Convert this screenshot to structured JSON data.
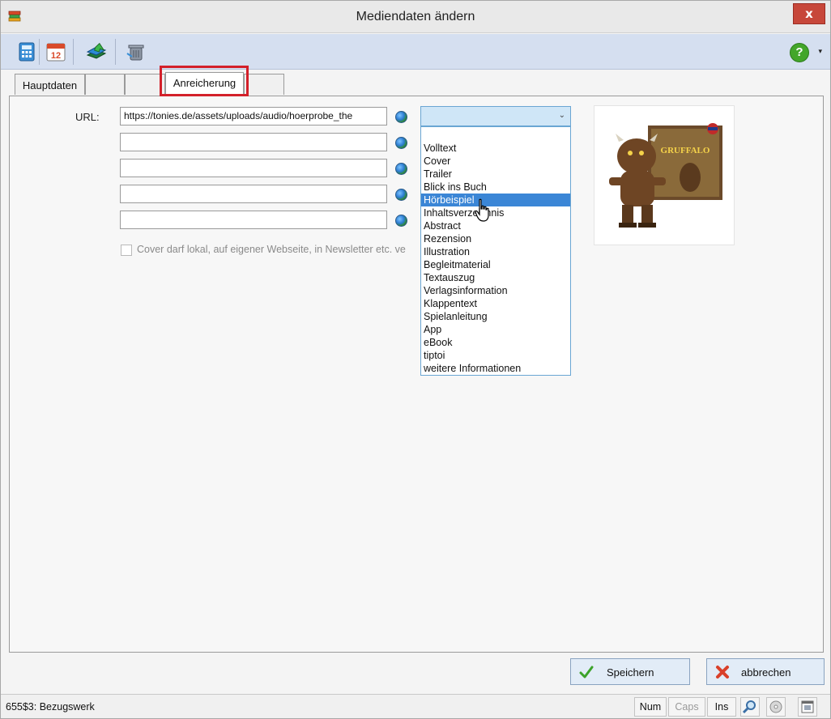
{
  "window": {
    "title": "Mediendaten ändern",
    "close_label": "x"
  },
  "toolbar": {
    "buttons": [
      "calculator-icon",
      "calendar-icon",
      "books-icon",
      "trash-icon"
    ],
    "calendar_number": "12",
    "help_label": "?",
    "help_caret": "▾"
  },
  "tabs": [
    {
      "label": "Hauptdaten",
      "active": false
    },
    {
      "label": "",
      "active": false
    },
    {
      "label": "",
      "active": false
    },
    {
      "label": "Anreicherung",
      "active": true
    },
    {
      "label": "",
      "active": false
    }
  ],
  "form": {
    "url_label": "URL:",
    "url_values": [
      "https://tonies.de/assets/uploads/audio/hoerprobe_the",
      "",
      "",
      "",
      ""
    ],
    "cover_checkbox_label": "Cover darf lokal, auf eigener Webseite, in Newsletter etc. ve",
    "cover_checked": false
  },
  "dropdown": {
    "selected_value": "",
    "arrow": "⌄",
    "options": [
      "Volltext",
      "Cover",
      "Trailer",
      "Blick ins Buch",
      "Hörbeispiel",
      "Inhaltsverzeichnis",
      "Abstract",
      "Rezension",
      "Illustration",
      "Begleitmaterial",
      "Textauszug",
      "Verlagsinformation",
      "Klappentext",
      "Spielanleitung",
      "App",
      "eBook",
      "tiptoi",
      "weitere Informationen"
    ],
    "highlighted_index": 4
  },
  "buttons": {
    "save_label": "Speichern",
    "cancel_label": "abbrechen"
  },
  "status": {
    "text": "655$3: Bezugswerk",
    "num": "Num",
    "caps": "Caps",
    "ins": "Ins"
  },
  "colors": {
    "highlight_border": "#d3202a",
    "selected_item": "#3b86d6",
    "toolbar_bg": "#d5dff0"
  }
}
